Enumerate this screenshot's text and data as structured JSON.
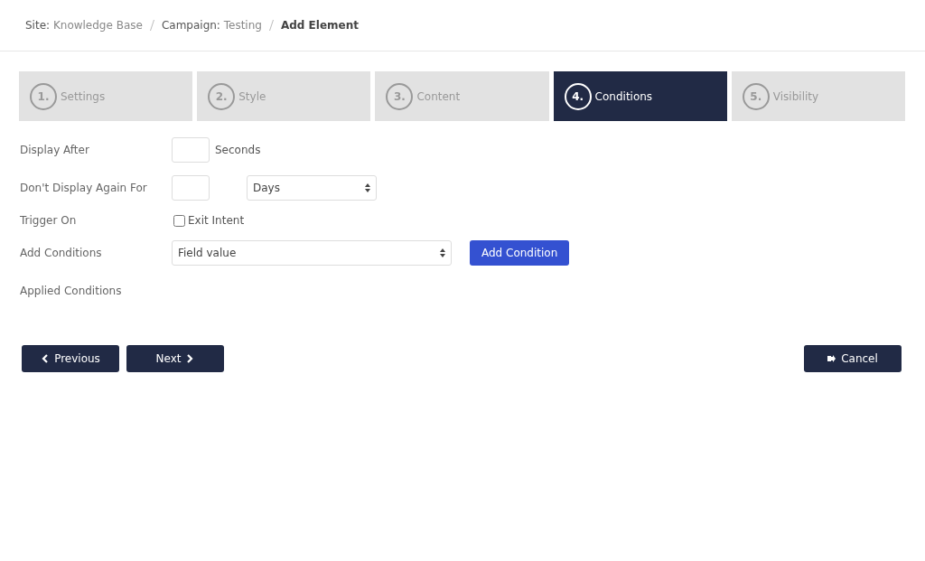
{
  "breadcrumb": [
    {
      "text": "**Site:** Knowledge Base",
      "current": false
    },
    {
      "text": "**Campaign:** Testing",
      "current": false
    },
    {
      "text": "Add Element",
      "current": true
    }
  ],
  "steps": [
    {
      "number": "1.",
      "label": "Settings",
      "selected": false
    },
    {
      "number": "2.",
      "label": "Style",
      "selected": false
    },
    {
      "number": "3.",
      "label": "Content",
      "selected": false
    },
    {
      "number": "4.",
      "label": "Conditions",
      "selected": true
    },
    {
      "number": "5.",
      "label": "Visibility",
      "selected": false
    }
  ],
  "form": {
    "display_after": {
      "label": "Display After",
      "unit": "Seconds"
    },
    "dont_display_again": {
      "label": "Don't Display Again For",
      "period": "Days"
    },
    "trigger_on": {
      "label": "Trigger On",
      "option": "Exit Intent",
      "checked": false
    },
    "add_conditions": {
      "label": "Add Conditions",
      "selection": "Field value",
      "button": "Add Condition"
    },
    "applied_conditions": {
      "label": "Applied Conditions"
    }
  },
  "buttons": {
    "previous": "Previous",
    "next": "Next",
    "cancel": "Cancel"
  }
}
